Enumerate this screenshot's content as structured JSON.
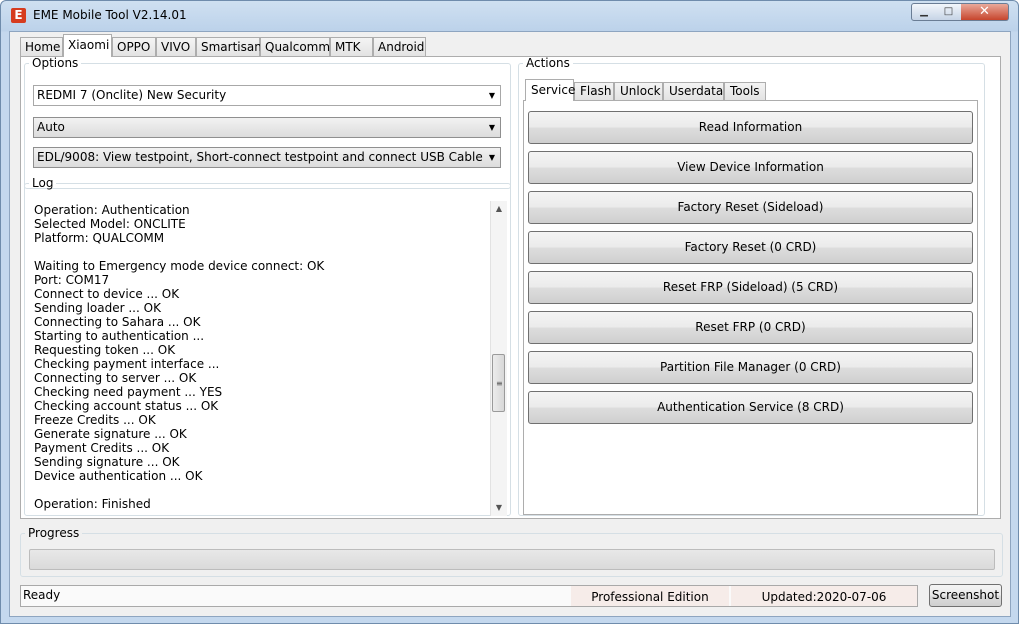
{
  "window": {
    "title": "EME Mobile Tool V2.14.01",
    "app_icon_glyph": "E",
    "controls": {
      "minimize": "▁",
      "maximize": "□",
      "close": "✕"
    }
  },
  "main_tabs": [
    {
      "label": "Home",
      "active": false
    },
    {
      "label": "Xiaomi",
      "active": true
    },
    {
      "label": "OPPO",
      "active": false
    },
    {
      "label": "VIVO",
      "active": false
    },
    {
      "label": "Smartisan",
      "active": false
    },
    {
      "label": "Qualcomm",
      "active": false
    },
    {
      "label": "MTK",
      "active": false
    },
    {
      "label": "Android",
      "active": false
    }
  ],
  "options": {
    "legend": "Options",
    "model_select": "REDMI 7 (Onclite) New Security",
    "mode_select": "Auto",
    "connect_select": "EDL/9008: View testpoint, Short-connect testpoint and connect USB Cable"
  },
  "log": {
    "legend": "Log",
    "lines": [
      "Operation: Authentication",
      "Selected Model: ONCLITE",
      "Platform: QUALCOMM",
      "",
      "Waiting to Emergency mode device connect: OK",
      "Port: COM17",
      "Connect to device ... OK",
      "Sending loader ... OK",
      "Connecting to Sahara ... OK",
      "Starting to authentication ...",
      "Requesting token ... OK",
      "Checking payment interface ...",
      "Connecting to server ... OK",
      "Checking need payment ... YES",
      "Checking account status ... OK",
      "Freeze Credits ... OK",
      "Generate signature ... OK",
      "Payment Credits ... OK",
      "Sending signature ... OK",
      "Device authentication ... OK",
      "",
      "Operation: Finished"
    ]
  },
  "actions": {
    "legend": "Actions",
    "sub_tabs": [
      {
        "label": "Service",
        "active": true
      },
      {
        "label": "Flash",
        "active": false
      },
      {
        "label": "Unlock",
        "active": false
      },
      {
        "label": "Userdata",
        "active": false
      },
      {
        "label": "Tools",
        "active": false
      }
    ],
    "buttons": [
      "Read Information",
      "View Device Information",
      "Factory Reset (Sideload)",
      "Factory Reset (0 CRD)",
      "Reset FRP (Sideload) (5 CRD)",
      "Reset FRP (0 CRD)",
      "Partition File Manager (0 CRD)",
      "Authentication Service (8 CRD)"
    ]
  },
  "progress": {
    "legend": "Progress",
    "value_percent": 0
  },
  "status": {
    "ready": "Ready",
    "edition": "Professional Edition",
    "updated": "Updated:2020-07-06",
    "screenshot_label": "Screenshot"
  },
  "colors": {
    "app_icon": "#d63c1f",
    "status_highlight": "#f6ece9"
  }
}
